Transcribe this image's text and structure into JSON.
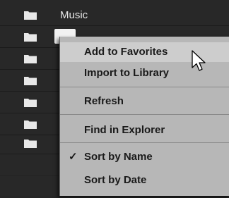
{
  "browser": {
    "rows": [
      {
        "name": "Music"
      },
      {
        "name": ""
      },
      {
        "name": ""
      },
      {
        "name": ""
      },
      {
        "name": ""
      },
      {
        "name": ""
      },
      {
        "name": ""
      }
    ]
  },
  "context_menu": {
    "add_to_favorites": "Add to Favorites",
    "import_to_library": "Import to Library",
    "refresh": "Refresh",
    "find_in_explorer": "Find in Explorer",
    "sort_by_name": "Sort by Name",
    "sort_by_name_check": "✓",
    "sort_by_date": "Sort by Date"
  },
  "icons": {
    "folder": "folder-icon",
    "cursor": "mouse-pointer-icon"
  },
  "colors": {
    "panel_background": "#282828",
    "menu_background": "#b7b7b7",
    "menu_hover": "#cdcdcd",
    "folder_icon": "#e8e8e8"
  }
}
